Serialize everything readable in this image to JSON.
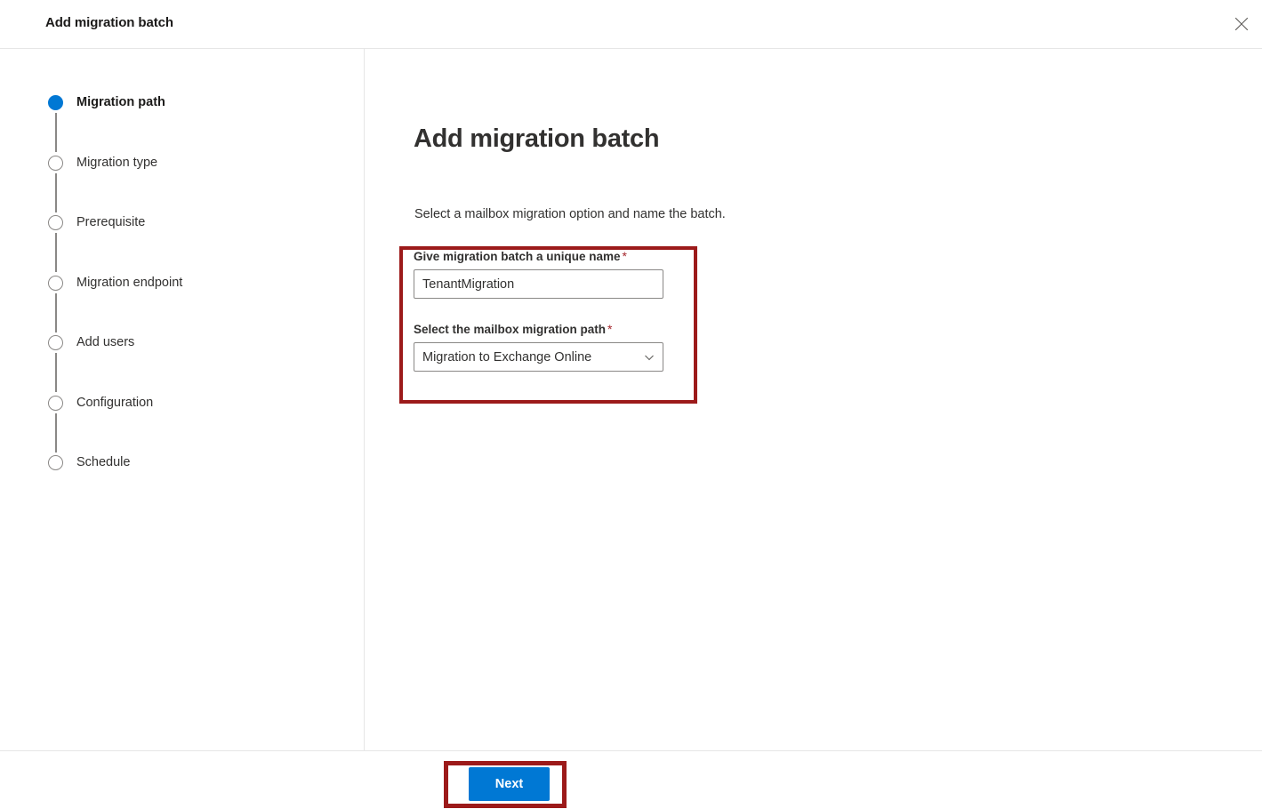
{
  "window": {
    "title": "Add migration batch",
    "close_icon": "close-icon"
  },
  "stepper": {
    "steps": [
      {
        "label": "Migration path",
        "state": "active"
      },
      {
        "label": "Migration type",
        "state": "pending"
      },
      {
        "label": "Prerequisite",
        "state": "pending"
      },
      {
        "label": "Migration endpoint",
        "state": "pending"
      },
      {
        "label": "Add users",
        "state": "pending"
      },
      {
        "label": "Configuration",
        "state": "pending"
      },
      {
        "label": "Schedule",
        "state": "pending"
      }
    ]
  },
  "main": {
    "heading": "Add migration batch",
    "description": "Select a mailbox migration option and name the batch.",
    "fields": {
      "batch_name": {
        "label": "Give migration batch a unique name",
        "required_mark": "*",
        "value": "TenantMigration",
        "placeholder": ""
      },
      "migration_path": {
        "label": "Select the mailbox migration path",
        "required_mark": "*",
        "selected": "Migration to Exchange Online",
        "chevron_icon": "chevron-down-icon"
      }
    }
  },
  "footer": {
    "next_label": "Next"
  },
  "colors": {
    "accent_blue": "#0078d4",
    "highlight_red": "#9c1a1a",
    "required_red": "#a4262c",
    "text_primary": "#323130",
    "border_gray": "#8a8886",
    "divider": "#e6e6e6"
  }
}
